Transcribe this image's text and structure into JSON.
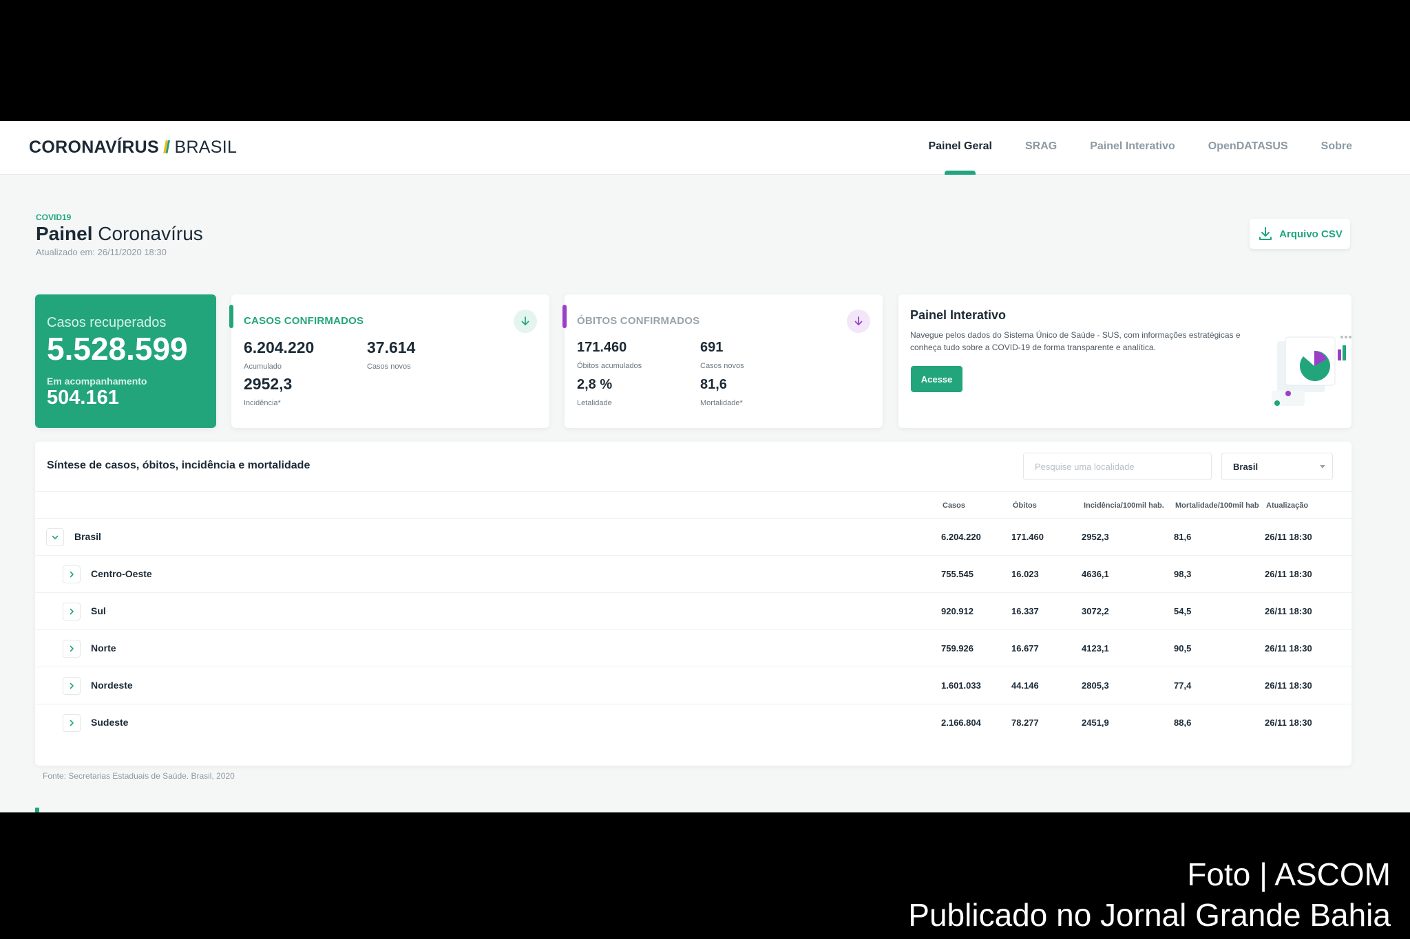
{
  "header": {
    "brand_part1": "CORONAVÍRUS",
    "brand_part2": "BRASIL",
    "nav": [
      {
        "label": "Painel Geral",
        "active": true
      },
      {
        "label": "SRAG",
        "active": false
      },
      {
        "label": "Painel Interativo",
        "active": false
      },
      {
        "label": "OpenDATASUS",
        "active": false
      },
      {
        "label": "Sobre",
        "active": false
      }
    ]
  },
  "page": {
    "tag": "COVID19",
    "title_bold": "Painel",
    "title_rest": "Coronavírus",
    "updated": "Atualizado em: 26/11/2020 18:30",
    "csv_button": "Arquivo CSV"
  },
  "recovered": {
    "label": "Casos recuperados",
    "value": "5.528.599",
    "follow_label": "Em acompanhamento",
    "follow_value": "504.161"
  },
  "cases": {
    "title": "CASOS CONFIRMADOS",
    "accumulated": "6.204.220",
    "accumulated_label": "Acumulado",
    "new": "37.614",
    "new_label": "Casos novos",
    "incidence": "2952,3",
    "incidence_label": "Incidência*"
  },
  "deaths": {
    "title": "ÓBITOS CONFIRMADOS",
    "accumulated": "171.460",
    "accumulated_label": "Óbitos acumulados",
    "new": "691",
    "new_label": "Casos novos",
    "lethality": "2,8 %",
    "lethality_label": "Letalidade",
    "mortality": "81,6",
    "mortality_label": "Mortalidade*"
  },
  "interactive": {
    "title": "Painel Interativo",
    "description": "Navegue pelos dados do Sistema Único de Saúde - SUS, com informações estratégicas e conheça tudo sobre a COVID-19 de forma transparente e analítica.",
    "button": "Acesse"
  },
  "table": {
    "title": "Síntese de casos, óbitos, incidência e mortalidade",
    "search_placeholder": "Pesquise uma localidade",
    "select_value": "Brasil",
    "headers": [
      "Casos",
      "Óbitos",
      "Incidência/100mil hab.",
      "Mortalidade/100mil hab",
      "Atualização"
    ],
    "rows": [
      {
        "name": "Brasil",
        "casos": "6.204.220",
        "obitos": "171.460",
        "incidencia": "2952,3",
        "mortalidade": "81,6",
        "atualizacao": "26/11 18:30"
      },
      {
        "name": "Centro-Oeste",
        "casos": "755.545",
        "obitos": "16.023",
        "incidencia": "4636,1",
        "mortalidade": "98,3",
        "atualizacao": "26/11 18:30"
      },
      {
        "name": "Sul",
        "casos": "920.912",
        "obitos": "16.337",
        "incidencia": "3072,2",
        "mortalidade": "54,5",
        "atualizacao": "26/11 18:30"
      },
      {
        "name": "Norte",
        "casos": "759.926",
        "obitos": "16.677",
        "incidencia": "4123,1",
        "mortalidade": "90,5",
        "atualizacao": "26/11 18:30"
      },
      {
        "name": "Nordeste",
        "casos": "1.601.033",
        "obitos": "44.146",
        "incidencia": "2805,3",
        "mortalidade": "77,4",
        "atualizacao": "26/11 18:30"
      },
      {
        "name": "Sudeste",
        "casos": "2.166.804",
        "obitos": "78.277",
        "incidencia": "2451,9",
        "mortalidade": "88,6",
        "atualizacao": "26/11 18:30"
      }
    ],
    "source": "Fonte: Secretarias Estaduais de Saúde. Brasil, 2020"
  },
  "credits": {
    "line1": "Foto | ASCOM",
    "line2": "Publicado no Jornal Grande Bahia"
  },
  "colors": {
    "brand_green": "#23a57c",
    "accent_yellow": "#f2b705",
    "purple": "#9b3fc9"
  }
}
